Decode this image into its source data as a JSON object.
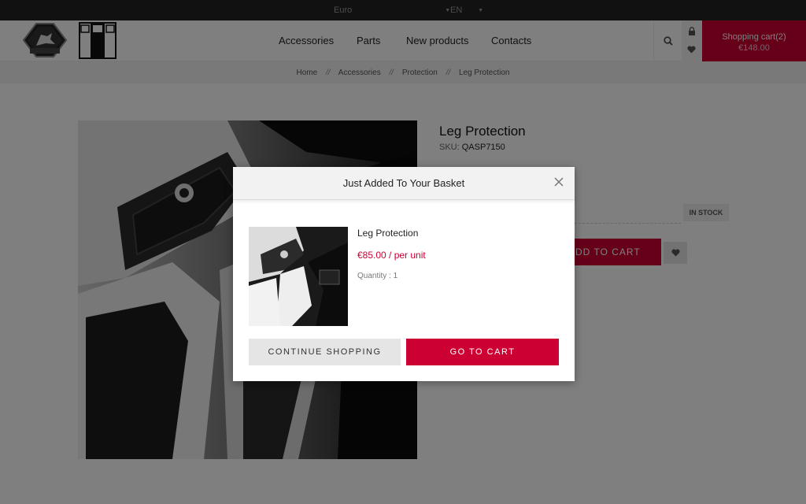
{
  "topbar": {
    "currency": "Euro",
    "language": "EN"
  },
  "header": {
    "nav": [
      {
        "label": "Accessories"
      },
      {
        "label": "Parts"
      },
      {
        "label": "New products"
      },
      {
        "label": "Contacts"
      }
    ],
    "cart": {
      "label": "Shopping cart",
      "count": "(2)",
      "total": "€148.00"
    }
  },
  "breadcrumb": {
    "items": [
      "Home",
      "Accessories",
      "Protection",
      "Leg Protection"
    ],
    "separator": "//"
  },
  "product": {
    "title": "Leg Protection",
    "sku_label": "SKU:",
    "sku_value": "QASP7150",
    "stock": "IN STOCK",
    "add_to_cart_label": "ADD TO CART"
  },
  "modal": {
    "title": "Just Added To Your Basket",
    "item_name": "Leg Protection",
    "item_price": "€85.00 / per unit",
    "item_quantity": "Quantity : 1",
    "continue_label": "CONTINUE SHOPPING",
    "go_to_cart_label": "GO TO CART"
  },
  "colors": {
    "accent": "#cc0033",
    "topbar": "#222222"
  }
}
